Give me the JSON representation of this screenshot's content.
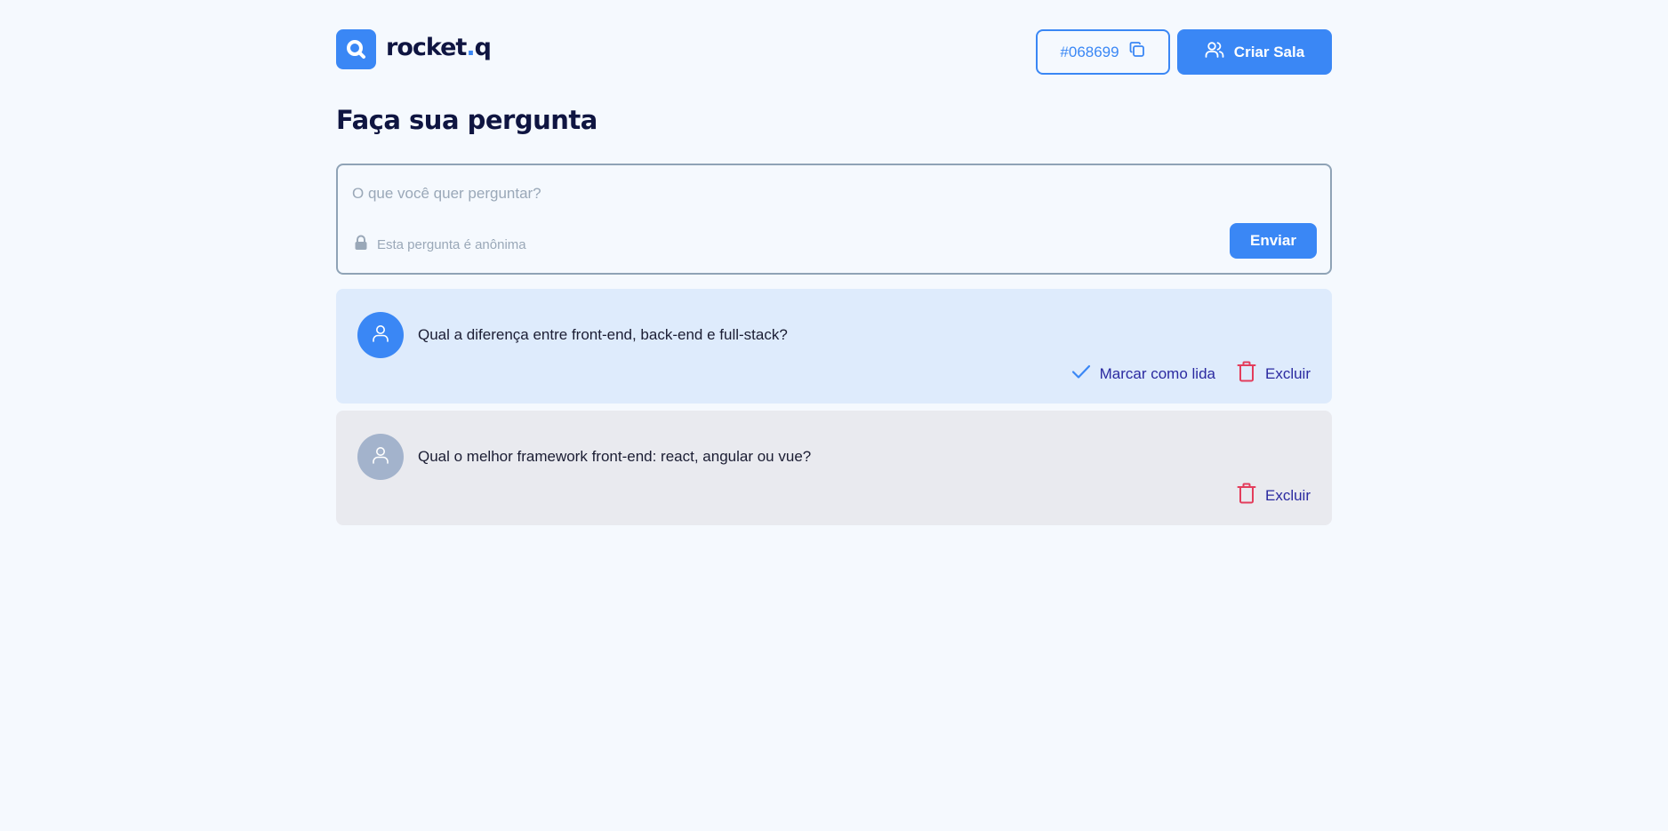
{
  "header": {
    "logo_text": "rocket",
    "logo_dot": ".",
    "logo_suffix": "q",
    "room_code": "#068699",
    "create_room_label": "Criar Sala"
  },
  "page": {
    "title": "Faça sua pergunta"
  },
  "form": {
    "placeholder": "O que você quer perguntar?",
    "value": "",
    "anonymous_note": "Esta pergunta é anônima",
    "send_label": "Enviar"
  },
  "questions": [
    {
      "text": "Qual a diferença entre front-end, back-end e full-stack?",
      "status": "unread",
      "mark_read_label": "Marcar como lida",
      "delete_label": "Excluir"
    },
    {
      "text": "Qual o melhor framework front-end: react, angular ou vue?",
      "status": "read",
      "delete_label": "Excluir"
    }
  ],
  "colors": {
    "primary": "#3a87f5",
    "title": "#0f1541",
    "unread_bg": "#deebfc",
    "read_bg": "#e9eaef",
    "action_text": "#2b2aa0",
    "delete_icon": "#e33d5c",
    "background": "#f5f9fe"
  },
  "icons": {
    "logo": "search-logo-icon",
    "copy": "copy-icon",
    "users": "users-icon",
    "lock": "lock-icon",
    "user": "user-icon",
    "check": "check-icon",
    "trash": "trash-icon"
  }
}
